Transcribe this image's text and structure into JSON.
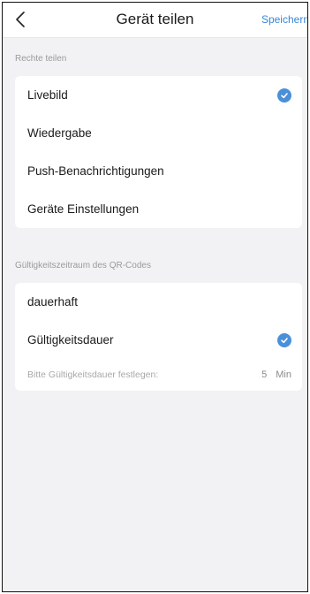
{
  "header": {
    "title": "Gerät teilen",
    "save_label": "Speichern",
    "back_icon": "chevron-left-icon"
  },
  "rights_section": {
    "label": "Rechte teilen",
    "items": [
      {
        "label": "Livebild",
        "checked": true
      },
      {
        "label": "Wiedergabe",
        "checked": false
      },
      {
        "label": "Push-Benachrichtigungen",
        "checked": false
      },
      {
        "label": "Geräte Einstellungen",
        "checked": false
      }
    ]
  },
  "validity_section": {
    "label": "Gültigkeitszeitraum des QR-Codes",
    "options": [
      {
        "label": "dauerhaft",
        "checked": false
      },
      {
        "label": "Gültigkeitsdauer",
        "checked": true
      }
    ],
    "duration": {
      "label": "Bitte Gültigkeitsdauer festlegen:",
      "value": "5",
      "unit": "Min"
    }
  },
  "colors": {
    "accent": "#3a86d6",
    "check": "#4a90d9",
    "background": "#f2f2f4",
    "card": "#ffffff",
    "muted_text": "#9a9a9a"
  }
}
